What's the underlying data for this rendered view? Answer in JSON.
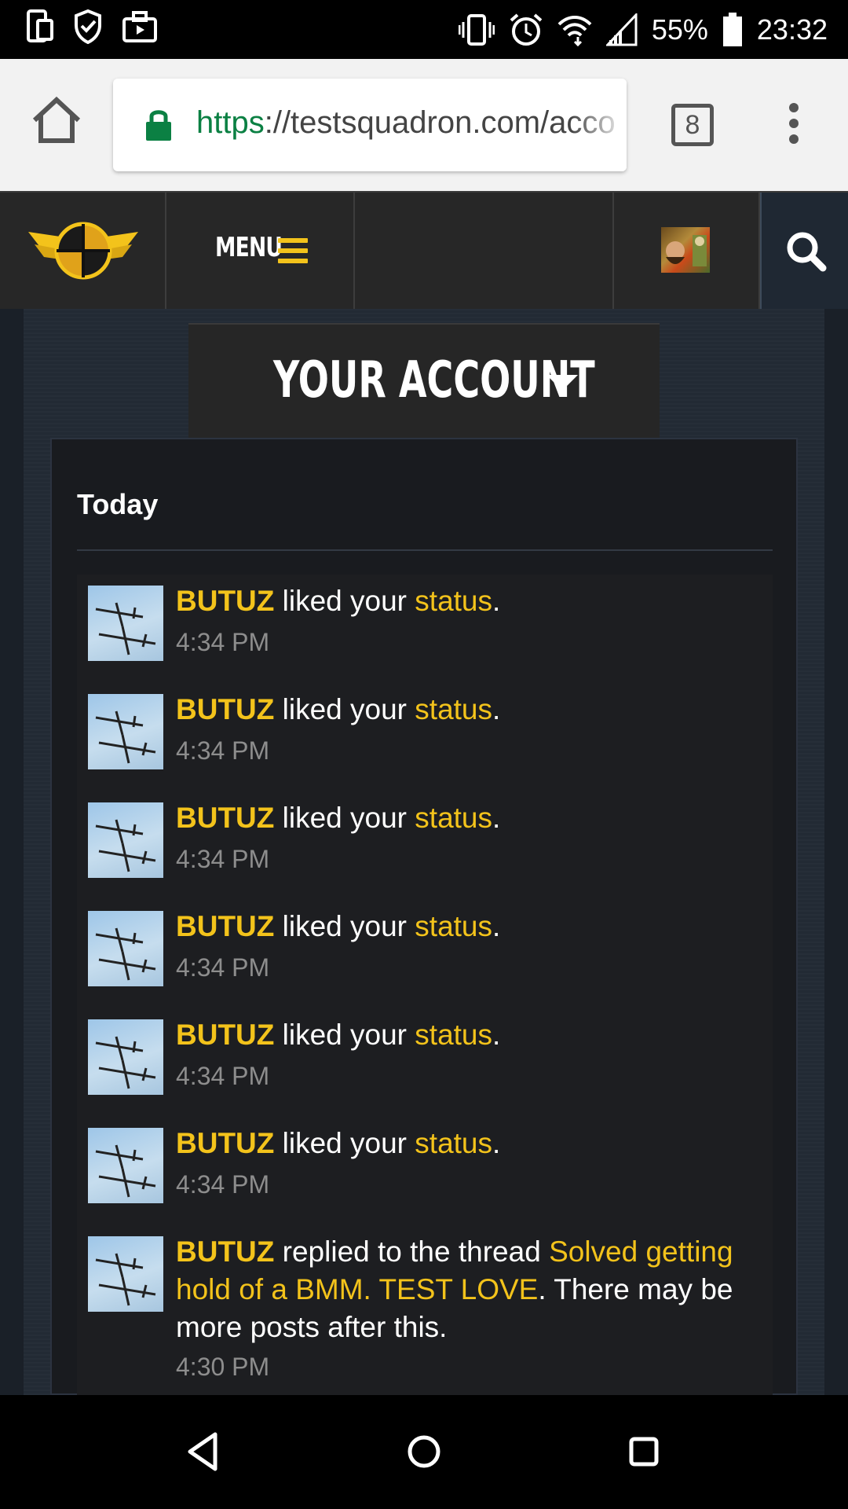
{
  "status_bar": {
    "battery": "55%",
    "time": "23:32",
    "icons": [
      "screenshot-icon",
      "shield-check-icon",
      "briefcase-icon",
      "vibrate-icon",
      "alarm-icon",
      "wifi-icon",
      "signal-icon",
      "battery-icon"
    ]
  },
  "browser": {
    "url_scheme": "https",
    "url_rest": "://testsquadron.com/acco",
    "tab_count": "8"
  },
  "site_nav": {
    "menu_label": "MENU"
  },
  "account": {
    "title": "YOUR ACCOUNT"
  },
  "notifications": {
    "section_label": "Today",
    "items": [
      {
        "user": "BUTUZ",
        "action": " liked your ",
        "link": "status",
        "tail": ".",
        "time": "4:34 PM"
      },
      {
        "user": "BUTUZ",
        "action": " liked your ",
        "link": "status",
        "tail": ".",
        "time": "4:34 PM"
      },
      {
        "user": "BUTUZ",
        "action": " liked your ",
        "link": "status",
        "tail": ".",
        "time": "4:34 PM"
      },
      {
        "user": "BUTUZ",
        "action": " liked your ",
        "link": "status",
        "tail": ".",
        "time": "4:34 PM"
      },
      {
        "user": "BUTUZ",
        "action": " liked your ",
        "link": "status",
        "tail": ".",
        "time": "4:34 PM"
      },
      {
        "user": "BUTUZ",
        "action": " liked your ",
        "link": "status",
        "tail": ".",
        "time": "4:34 PM"
      },
      {
        "user": "BUTUZ",
        "action": " replied to the thread ",
        "link": "Solved getting hold of a BMM. TEST LOVE",
        "tail": ". There may be more posts after this.",
        "time": "4:30 PM"
      }
    ]
  },
  "colors": {
    "accent": "#f3c31b",
    "nav_bg": "#272727",
    "panel_bg": "#191b1f"
  }
}
